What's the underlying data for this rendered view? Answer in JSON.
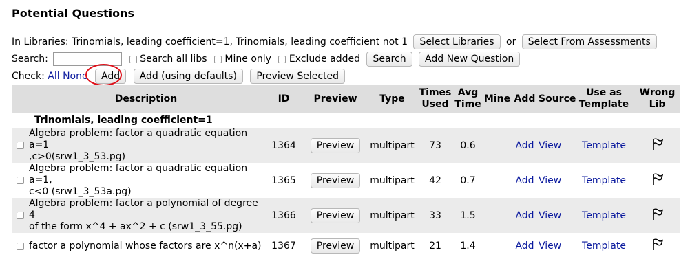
{
  "title": "Potential Questions",
  "libraries": {
    "label": "In Libraries: Trinomials, leading coefficient=1, Trinomials, leading coefficient not 1",
    "select_libraries": "Select Libraries",
    "or_text": "or",
    "select_from_assessments": "Select From Assessments"
  },
  "search": {
    "label": "Search:",
    "value": "",
    "search_all_libs": "Search all libs",
    "mine_only": "Mine only",
    "exclude_added": "Exclude added",
    "search_button": "Search",
    "add_new_question": "Add New Question"
  },
  "check": {
    "label": "Check:",
    "all": "All",
    "none": "None",
    "add": "Add",
    "add_defaults": "Add (using defaults)",
    "preview_selected": "Preview Selected"
  },
  "table": {
    "headers": {
      "description": "Description",
      "id": "ID",
      "preview": "Preview",
      "type": "Type",
      "times_used_1": "Times",
      "times_used_2": "Used",
      "avg_time_1": "Avg",
      "avg_time_2": "Time",
      "mine": "Mine",
      "add": "Add",
      "source": "Source",
      "use_as_template_1": "Use as",
      "use_as_template_2": "Template",
      "wrong_lib_1": "Wrong",
      "wrong_lib_2": "Lib"
    },
    "group": "Trinomials, leading coefficient=1",
    "rows": [
      {
        "desc1": "Algebra problem: factor a quadratic equation a=1",
        "desc2": ",c>0(srw1_3_53.pg)",
        "id": "1364",
        "preview": "Preview",
        "type": "multipart",
        "times_used": "73",
        "avg_time": "0.6",
        "add": "Add",
        "source": "View",
        "template": "Template"
      },
      {
        "desc1": "Algebra problem: factor a quadratic equation a=1,",
        "desc2": "c<0 (srw1_3_53a.pg)",
        "id": "1365",
        "preview": "Preview",
        "type": "multipart",
        "times_used": "42",
        "avg_time": "0.7",
        "add": "Add",
        "source": "View",
        "template": "Template"
      },
      {
        "desc1": "Algebra problem: factor a polynomial of degree 4",
        "desc2": "of the form x^4 + ax^2 + c (srw1_3_55.pg)",
        "id": "1366",
        "preview": "Preview",
        "type": "multipart",
        "times_used": "33",
        "avg_time": "1.5",
        "add": "Add",
        "source": "View",
        "template": "Template"
      },
      {
        "desc1": "factor a polynomial whose factors are x^n(x+a)",
        "desc2": "",
        "id": "1367",
        "preview": "Preview",
        "type": "multipart",
        "times_used": "21",
        "avg_time": "1.4",
        "add": "Add",
        "source": "View",
        "template": "Template"
      }
    ]
  },
  "icons": {
    "flag": "flag-icon",
    "checkbox": "checkbox"
  },
  "colors": {
    "link": "#0b1a9e",
    "highlight_circle": "#e0101a",
    "header_bg": "#dedede",
    "alt_row_bg": "#ebebeb"
  }
}
